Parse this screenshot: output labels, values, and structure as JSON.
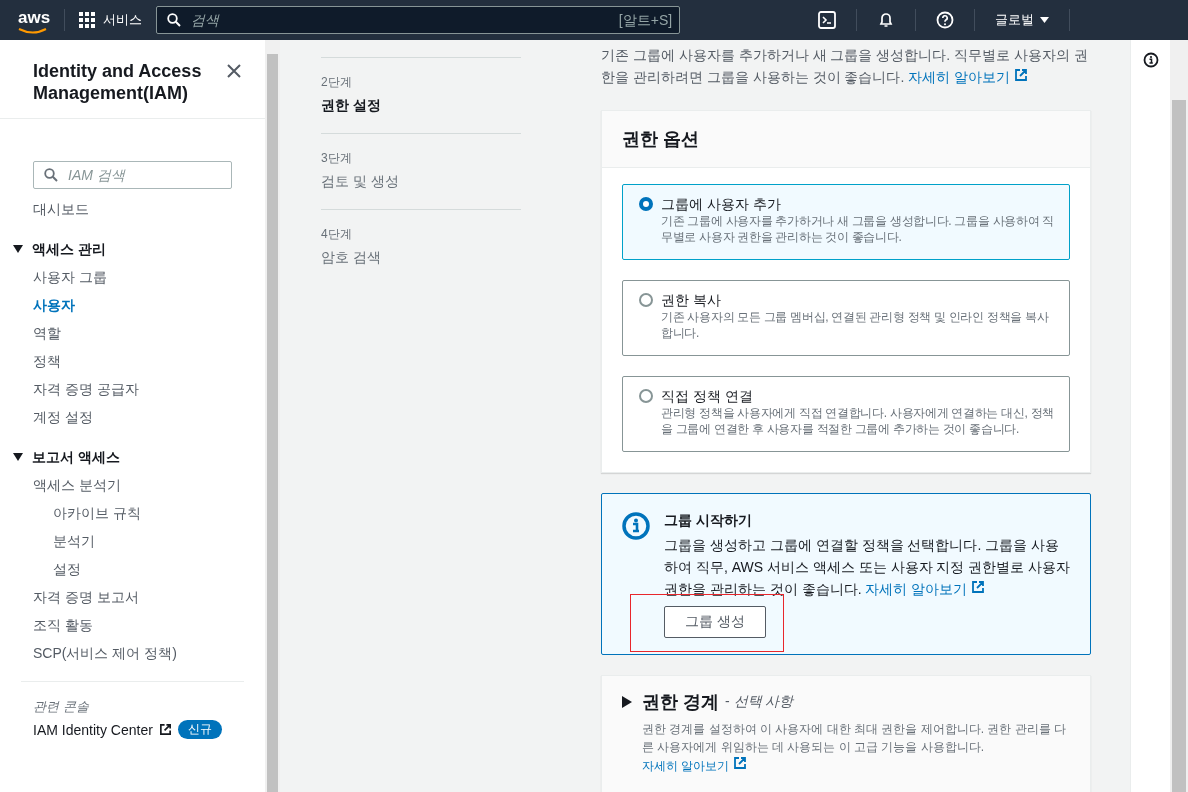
{
  "nav": {
    "logo": "aws",
    "services": "서비스",
    "search_placeholder": "검색",
    "shortcut": "[알트+S]",
    "region": "글로벌"
  },
  "sidebar": {
    "title": "Identity and Access Management(IAM)",
    "search_placeholder": "IAM 검색",
    "items": [
      {
        "kind": "link",
        "label": "대시보드",
        "selected": false
      },
      {
        "kind": "section",
        "label": "액세스 관리",
        "expanded": true,
        "children": [
          {
            "label": "사용자 그룹",
            "selected": false
          },
          {
            "label": "사용자",
            "selected": true
          },
          {
            "label": "역할",
            "selected": false
          },
          {
            "label": "정책",
            "selected": false
          },
          {
            "label": "자격 증명 공급자",
            "selected": false
          },
          {
            "label": "계정 설정",
            "selected": false
          }
        ]
      },
      {
        "kind": "section",
        "label": "보고서 액세스",
        "expanded": true,
        "children": [
          {
            "label": "액세스 분석기",
            "selected": false,
            "children": [
              {
                "label": "아카이브 규칙",
                "selected": false
              },
              {
                "label": "분석기",
                "selected": false
              },
              {
                "label": "설정",
                "selected": false
              }
            ]
          },
          {
            "label": "자격 증명 보고서",
            "selected": false
          },
          {
            "label": "조직 활동",
            "selected": false
          },
          {
            "label": "SCP(서비스 제어 정책)",
            "selected": false
          }
        ]
      }
    ],
    "related": {
      "heading": "관련 콘솔",
      "link": "IAM Identity Center",
      "badge": "신규"
    }
  },
  "steps": [
    {
      "step": "2단계",
      "label": "권한 설정",
      "selected": true
    },
    {
      "step": "3단계",
      "label": "검토 및 생성",
      "selected": false
    },
    {
      "step": "4단계",
      "label": "암호 검색",
      "selected": false
    }
  ],
  "intro": {
    "text": "기존 그룹에 사용자를 추가하거나 새 그룹을 생성합니다. 직무별로 사용자의 권한을 관리하려면 그룹을 사용하는 것이 좋습니다.",
    "link": "자세히 알아보기"
  },
  "permission_options": {
    "title": "권한 옵션",
    "options": [
      {
        "label": "그룹에 사용자 추가",
        "description": "기존 그룹에 사용자를 추가하거나 새 그룹을 생성합니다. 그룹을 사용하여 직무별로 사용자 권한을 관리하는 것이 좋습니다.",
        "selected": true
      },
      {
        "label": "권한 복사",
        "description": "기존 사용자의 모든 그룹 멤버십, 연결된 관리형 정책 및 인라인 정책을 복사합니다.",
        "selected": false
      },
      {
        "label": "직접 정책 연결",
        "description": "관리형 정책을 사용자에게 직접 연결합니다. 사용자에게 연결하는 대신, 정책을 그룹에 연결한 후 사용자를 적절한 그룹에 추가하는 것이 좋습니다.",
        "selected": false
      }
    ]
  },
  "info_box": {
    "title": "그룹 시작하기",
    "text": "그룹을 생성하고 그룹에 연결할 정책을 선택합니다. 그룹을 사용하여 직무, AWS 서비스 액세스 또는 사용자 지정 권한별로 사용자 권한을 관리하는 것이 좋습니다.",
    "link": "자세히 알아보기",
    "button": {
      "label": "그룹 생성",
      "highlighted": true
    }
  },
  "boundary": {
    "title": "권한 경계",
    "separator": "-",
    "optional": "선택 사항",
    "expanded": false,
    "description": "권한 경계를 설정하여 이 사용자에 대한 최대 권한을 제어합니다. 권한 관리를 다른 사용자에게 위임하는 데 사용되는 이 고급 기능을 사용합니다.",
    "link": "자세히 알아보기"
  }
}
